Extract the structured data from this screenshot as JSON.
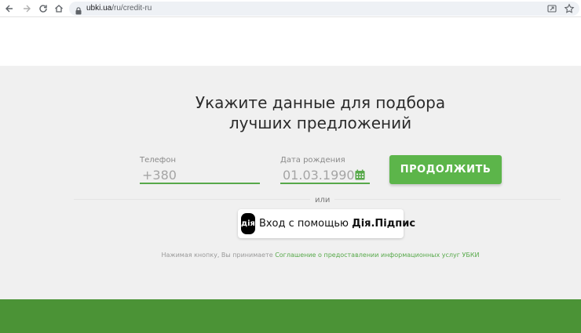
{
  "browser": {
    "url_host": "ubki.ua",
    "url_path": "/ru/credit-ru",
    "icons": [
      "back-icon",
      "forward-icon",
      "reload-icon",
      "home-icon",
      "lock-icon",
      "share-icon",
      "bookmark-star-icon"
    ]
  },
  "form": {
    "heading_line1": "Укажите данные для подбора",
    "heading_line2": "лучших предложений",
    "phone_label": "Телефон",
    "phone_value": "+380",
    "birthdate_label": "Дата рождения",
    "birthdate_value": "01.03.1990",
    "continue_label": "ПРОДОЛЖИТЬ",
    "or_text": "или",
    "diia_logo_text": "дія",
    "diia_prefix": "Вход с помощью ",
    "diia_brand": "Дія.Підпис",
    "consent_text": "Нажимая кнопку, Вы принимаете ",
    "consent_link": "Соглашение о предоставлении информационных услуг УБКИ"
  },
  "colors": {
    "accent_green": "#5cb54a",
    "footer_green": "#4b9336",
    "background_grey": "#f0f0f0"
  }
}
